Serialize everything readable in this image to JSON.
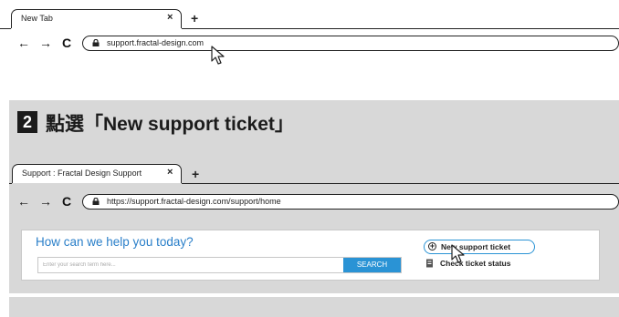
{
  "browser1": {
    "tab_title": "New Tab",
    "tab_close": "×",
    "new_tab": "+",
    "back": "←",
    "forward": "→",
    "reload": "C",
    "url": "support.fractal-design.com"
  },
  "step": {
    "number": "2",
    "text": "點選「New support ticket」"
  },
  "browser2": {
    "tab_title": "Support : Fractal Design Support",
    "tab_close": "×",
    "new_tab": "+",
    "back": "←",
    "forward": "→",
    "reload": "C",
    "url": "https://support.fractal-design.com/support/home"
  },
  "site": {
    "help_title": "How can we help you today?",
    "search_placeholder": "Enter your search term here...",
    "search_button": "SEARCH",
    "new_ticket": "New support ticket",
    "check_status": "Check ticket status"
  },
  "colors": {
    "band": "#d8d8d8",
    "accent": "#2a93d5",
    "title_blue": "#2a7fc9"
  }
}
